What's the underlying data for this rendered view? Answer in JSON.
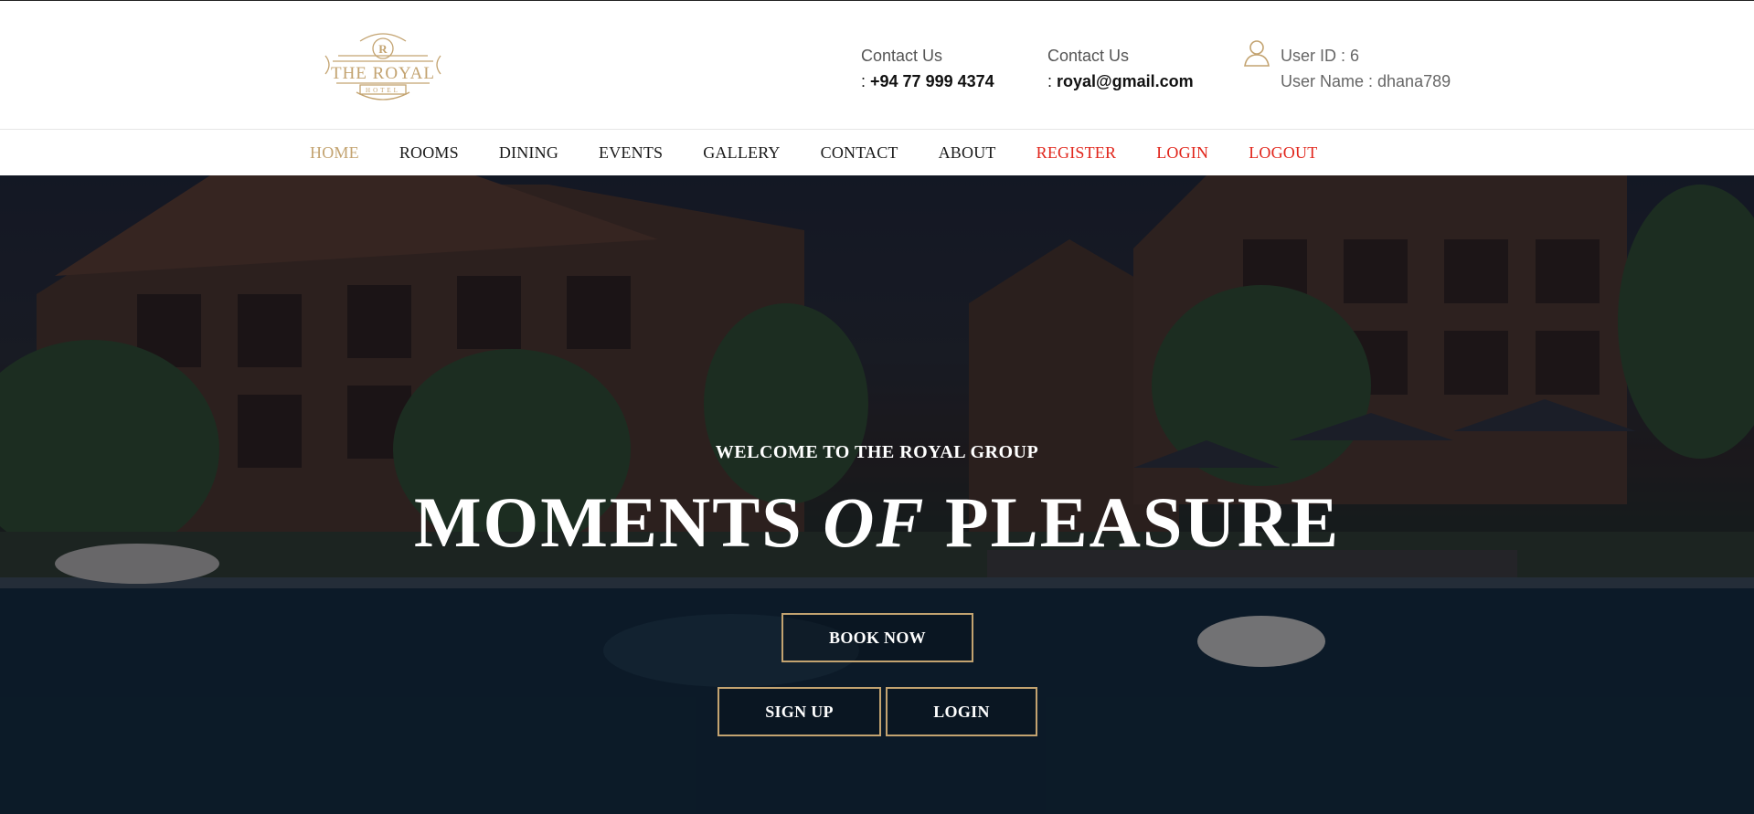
{
  "brand": {
    "logo_letter": "R",
    "logo_name": "THE ROYAL",
    "logo_sub": "HOTEL",
    "gold": "#c3a370"
  },
  "contact": {
    "phone_label": "Contact Us",
    "phone_value": "+94 77 999 4374",
    "email_label": "Contact Us",
    "email_value": "royal@gmail.com"
  },
  "user": {
    "icon": "user-icon",
    "id_text": "User ID : 6",
    "name_text": "User Name : dhana789"
  },
  "nav": {
    "items": [
      {
        "label": "HOME"
      },
      {
        "label": "ROOMS"
      },
      {
        "label": "DINING"
      },
      {
        "label": "EVENTS"
      },
      {
        "label": "GALLERY"
      },
      {
        "label": "CONTACT"
      },
      {
        "label": "ABOUT"
      },
      {
        "label": "REGISTER"
      },
      {
        "label": "LOGIN"
      },
      {
        "label": "LOGOUT"
      }
    ],
    "active_color": "#c3a370",
    "alert_color": "#e1251b"
  },
  "hero": {
    "welcome": "WELCOME TO THE ROYAL GROUP",
    "headline_part1": "MOMENTS",
    "headline_part2": "OF",
    "headline_part3": "PLEASURE",
    "book_label": "BOOK NOW",
    "signup_label": "SIGN UP",
    "login_label": "LOGIN"
  }
}
